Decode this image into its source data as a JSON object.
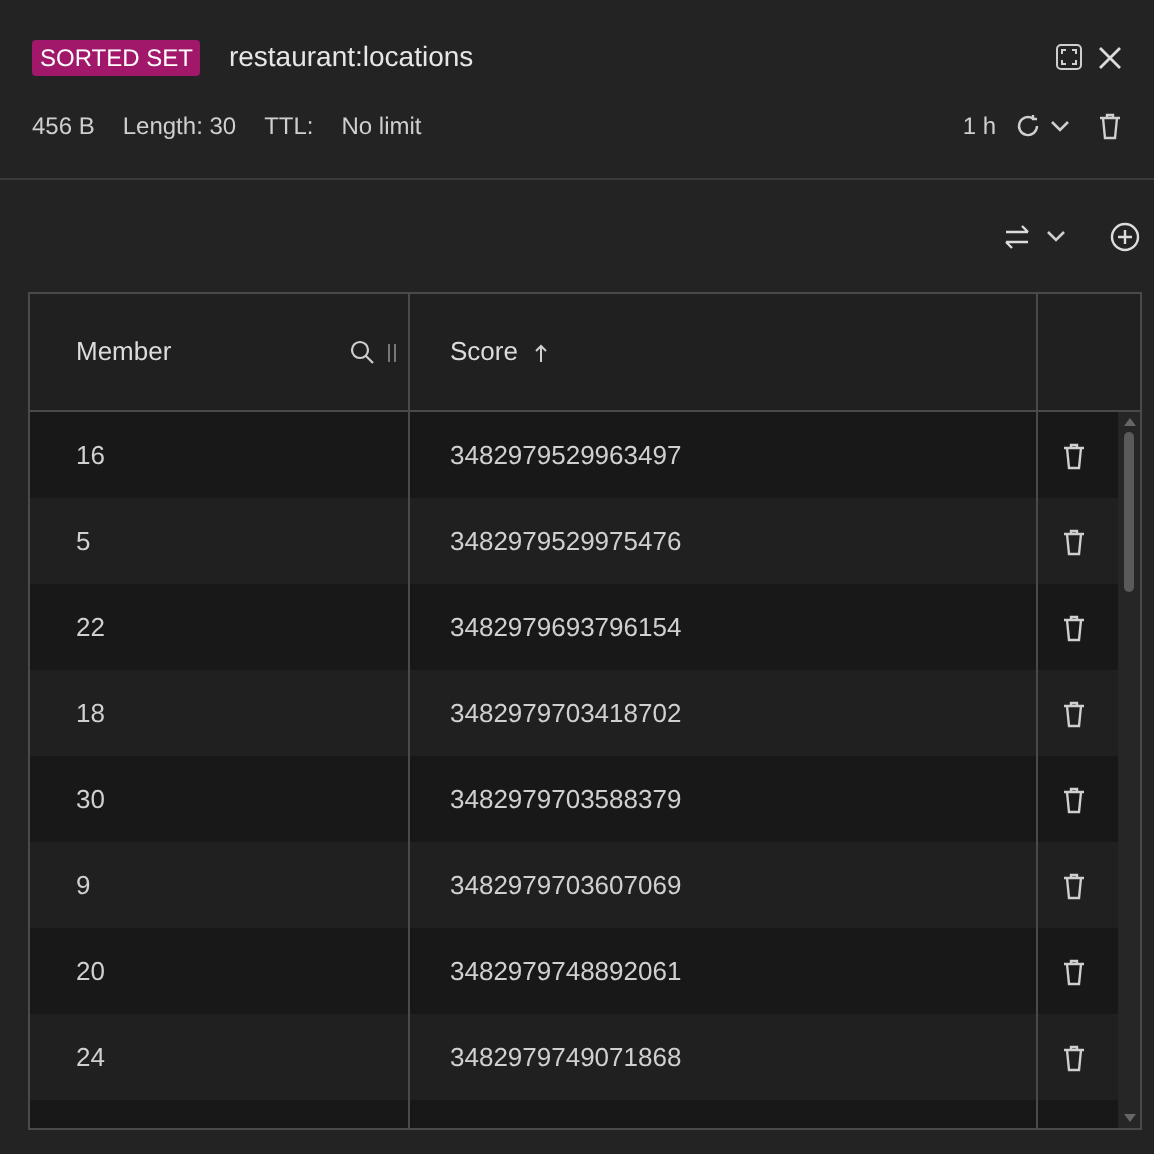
{
  "header": {
    "type_badge": "SORTED SET",
    "key_name": "restaurant:locations",
    "size": "456 B",
    "length": "Length: 30",
    "ttl_label": "TTL:",
    "ttl_value": "No limit",
    "refresh_interval": "1 h"
  },
  "table": {
    "columns": [
      {
        "label": "Member",
        "searchable": true
      },
      {
        "label": "Score",
        "sorted_ascending": true
      }
    ],
    "rows": [
      {
        "member": "16",
        "score": "3482979529963497"
      },
      {
        "member": "5",
        "score": "3482979529975476"
      },
      {
        "member": "22",
        "score": "3482979693796154"
      },
      {
        "member": "18",
        "score": "3482979703418702"
      },
      {
        "member": "30",
        "score": "3482979703588379"
      },
      {
        "member": "9",
        "score": "3482979703607069"
      },
      {
        "member": "20",
        "score": "3482979748892061"
      },
      {
        "member": "24",
        "score": "3482979749071868"
      }
    ]
  }
}
